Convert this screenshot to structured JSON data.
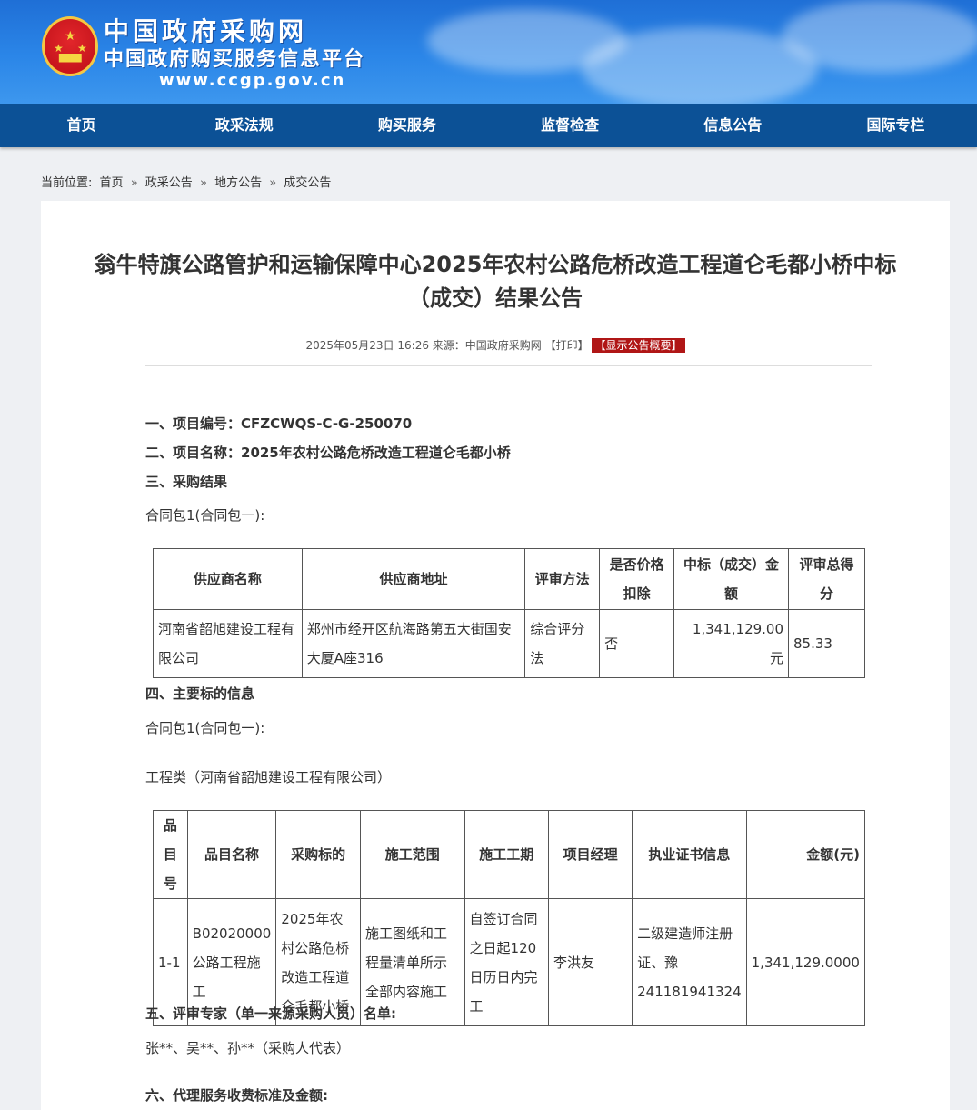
{
  "header": {
    "title_cn": "中国政府采购网",
    "subtitle_cn": "中国政府购买服务信息平台",
    "url": "www.ccgp.gov.cn"
  },
  "nav": [
    "首页",
    "政采法规",
    "购买服务",
    "监督检查",
    "信息公告",
    "国际专栏"
  ],
  "breadcrumb": {
    "prefix": "当前位置:",
    "items": [
      "首页",
      "政采公告",
      "地方公告",
      "成交公告"
    ],
    "separator": "»"
  },
  "article": {
    "title_line1": "翁牛特旗公路管护和运输保障中心2025年农村公路危桥改造工程道仑毛都小桥中标",
    "title_line2": "（成交）结果公告",
    "meta_date": "2025年05月23日 16:26",
    "meta_source": "来源：中国政府采购网",
    "meta_print": "【打印】",
    "meta_summary": "【显示公告概要】",
    "s1": "一、项目编号：CFZCWQS-C-G-250070",
    "s2": "二、项目名称：2025年农村公路危桥改造工程道仑毛都小桥",
    "s3": "三、采购结果",
    "pkg1": "合同包1(合同包一):",
    "s4": "四、主要标的信息",
    "pkg2": "合同包1(合同包一):",
    "category": "工程类（河南省韶旭建设工程有限公司）",
    "s5": "五、评审专家（单一来源采购人员）名单:",
    "experts": "张**、吴**、孙**（采购人代表）",
    "s6": "六、代理服务收费标准及金额:"
  },
  "result_table": {
    "headers": [
      "供应商名称",
      "供应商地址",
      "评审方法",
      "是否价格扣除",
      "中标（成交）金额",
      "评审总得分"
    ],
    "row": [
      "河南省韶旭建设工程有限公司",
      "郑州市经开区航海路第五大街国安大厦A座316",
      "综合评分法",
      "否",
      "1,341,129.00元",
      "85.33"
    ]
  },
  "item_table": {
    "headers": [
      "品目号",
      "品目名称",
      "采购标的",
      "施工范围",
      "施工工期",
      "项目经理",
      "执业证书信息",
      "金额(元)"
    ],
    "row": [
      "1-1",
      "B02020000公路工程施工",
      "2025年农村公路危桥改造工程道仑毛都小桥",
      "施工图纸和工程量清单所示全部内容施工",
      "自签订合同之日起120日历日内完工",
      "李洪友",
      "二级建造师注册证、豫241181941324",
      "1,341,129.0000"
    ]
  }
}
